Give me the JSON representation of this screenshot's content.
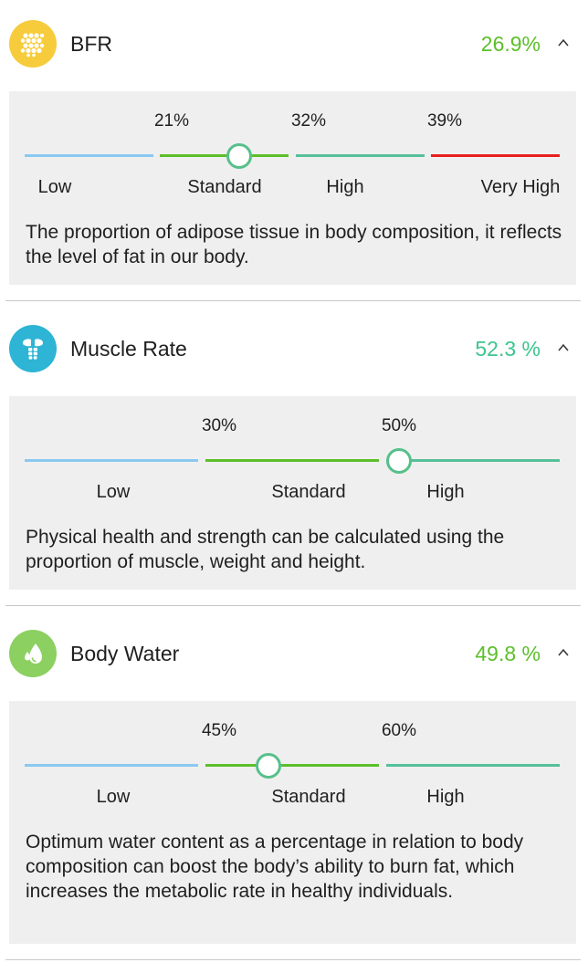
{
  "colors": {
    "low": "#8ac8f0",
    "standard": "#5cbf2a",
    "high": "#56c09a",
    "very_high": "#e8201c",
    "value_green": "#5cbf2a",
    "value_teal": "#3cc58e",
    "bfr_icon_bg": "#f6cc3c",
    "muscle_icon_bg": "#2eb4d4",
    "water_icon_bg": "#8bd060"
  },
  "sections": [
    {
      "title": "BFR",
      "value": "26.9%",
      "icon": "fat-cells-icon",
      "thresholds": [
        "21%",
        "32%",
        "39%"
      ],
      "bands": [
        "Low",
        "Standard",
        "High",
        "Very High"
      ],
      "description": "The proportion of adipose tissue in body composition, it reflects the level of fat in our body."
    },
    {
      "title": "Muscle Rate",
      "value": "52.3 %",
      "icon": "muscle-torso-icon",
      "thresholds": [
        "30%",
        "50%"
      ],
      "bands": [
        "Low",
        "Standard",
        "High"
      ],
      "description": "Physical health and strength can be calculated using the proportion of muscle, weight and height."
    },
    {
      "title": "Body Water",
      "value": "49.8 %",
      "icon": "water-drop-icon",
      "thresholds": [
        "45%",
        "60%"
      ],
      "bands": [
        "Low",
        "Standard",
        "High"
      ],
      "description": "Optimum water content as a percentage in relation to body composition can boost the body’s ability to burn fat, which increases the metabolic rate in healthy individuals."
    }
  ]
}
